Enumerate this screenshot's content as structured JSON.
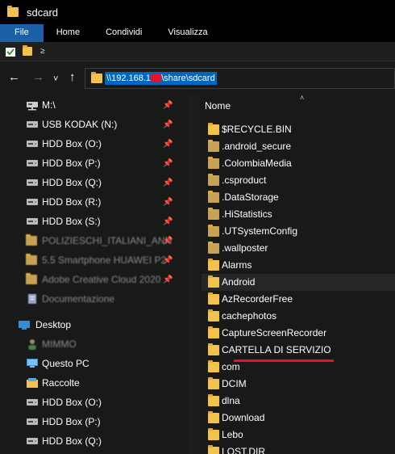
{
  "window": {
    "title": "sdcard"
  },
  "ribbon": {
    "tabs": [
      "File",
      "Home",
      "Condividi",
      "Visualizza"
    ]
  },
  "qat": {
    "dropdown": "≥"
  },
  "nav": {
    "back": "←",
    "forward": "→",
    "recent": "˅",
    "up": "↑"
  },
  "address": {
    "part1": "\\\\192.168.1",
    "part2": "\\share\\sdcard"
  },
  "sidebar": {
    "items": [
      {
        "label": "M:\\",
        "icon": "network-drive-icon",
        "pinned": true
      },
      {
        "label": "USB KODAK (N:)",
        "icon": "drive-icon",
        "pinned": true
      },
      {
        "label": "HDD Box (O:)",
        "icon": "drive-icon",
        "pinned": true
      },
      {
        "label": "HDD Box (P:)",
        "icon": "drive-icon",
        "pinned": true
      },
      {
        "label": "HDD Box (Q:)",
        "icon": "drive-icon",
        "pinned": true
      },
      {
        "label": "HDD Box (R:)",
        "icon": "drive-icon",
        "pinned": true
      },
      {
        "label": "HDD Box (S:)",
        "icon": "drive-icon",
        "pinned": true
      },
      {
        "label": "POLIZIESCHI_ITALIANI_ANN",
        "icon": "folder-icon",
        "pinned": true
      },
      {
        "label": "5.5 Smartphone HUAWEI P2",
        "icon": "folder-icon",
        "pinned": true
      },
      {
        "label": "Adobe Creative Cloud 2020",
        "icon": "folder-icon",
        "pinned": true
      },
      {
        "label": "Documentazione",
        "icon": "documents-icon",
        "pinned": false
      },
      {
        "label": "Desktop",
        "icon": "desktop-icon",
        "pinned": false
      },
      {
        "label": "MIMMO",
        "icon": "user-icon",
        "pinned": false
      },
      {
        "label": "Questo PC",
        "icon": "computer-icon",
        "pinned": false
      },
      {
        "label": "Raccolte",
        "icon": "libraries-icon",
        "pinned": false
      },
      {
        "label": "HDD Box (O:)",
        "icon": "drive-icon",
        "pinned": false
      },
      {
        "label": "HDD Box (P:)",
        "icon": "drive-icon",
        "pinned": false
      },
      {
        "label": "HDD Box (Q:)",
        "icon": "drive-icon",
        "pinned": false
      }
    ]
  },
  "content": {
    "column_header": "Nome",
    "sort_indicator": "˄",
    "files": [
      "$RECYCLE.BIN",
      ".android_secure",
      ".ColombiaMedia",
      ".csproduct",
      ".DataStorage",
      ".HiStatistics",
      ".UTSystemConfig",
      ".wallposter",
      "Alarms",
      "Android",
      "AzRecorderFree",
      "cachephotos",
      "CaptureScreenRecorder",
      "CARTELLA DI SERVIZIO",
      "com",
      "DCIM",
      "dlna",
      "Download",
      "Lebo",
      "LOST.DIR"
    ],
    "selected": "Android"
  },
  "colors": {
    "accent": "#0067c0",
    "file_tab": "#1a5fa8",
    "folder": "#f2c14e",
    "annotation": "#e8132a"
  }
}
